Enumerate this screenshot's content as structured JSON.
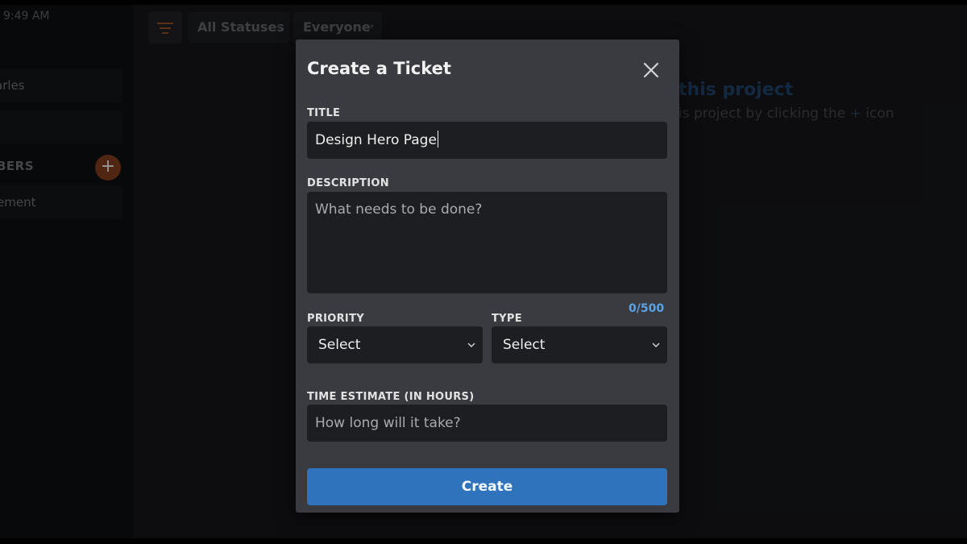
{
  "sidebar": {
    "time_text": "t 9:49 AM",
    "items": [
      {
        "label": "arles"
      },
      {
        "label": ""
      },
      {
        "label": "ement"
      }
    ],
    "members_heading": "BERS",
    "add_label": "+"
  },
  "filters": {
    "status": "All Statuses",
    "assignee": "Everyone"
  },
  "background": {
    "heading": "this project",
    "subtext_before": "is project by clicking the",
    "subtext_icon": "+",
    "subtext_after": "icon"
  },
  "modal": {
    "title": "Create a Ticket",
    "title_label": "TITLE",
    "title_value": "Design Hero Page",
    "description_label": "DESCRIPTION",
    "description_placeholder": "What needs to be done?",
    "char_counter": "0/500",
    "priority_label": "PRIORITY",
    "priority_value": "Select",
    "type_label": "TYPE",
    "type_value": "Select",
    "time_label": "TIME ESTIMATE (IN HOURS)",
    "time_placeholder": "How long will it take?",
    "create_label": "Create"
  },
  "colors": {
    "modal_bg": "#393b41",
    "field_bg": "#1d1e22",
    "primary_button": "#2f73bd",
    "counter": "#5aa3e6",
    "accent_orange": "#c0602a"
  }
}
